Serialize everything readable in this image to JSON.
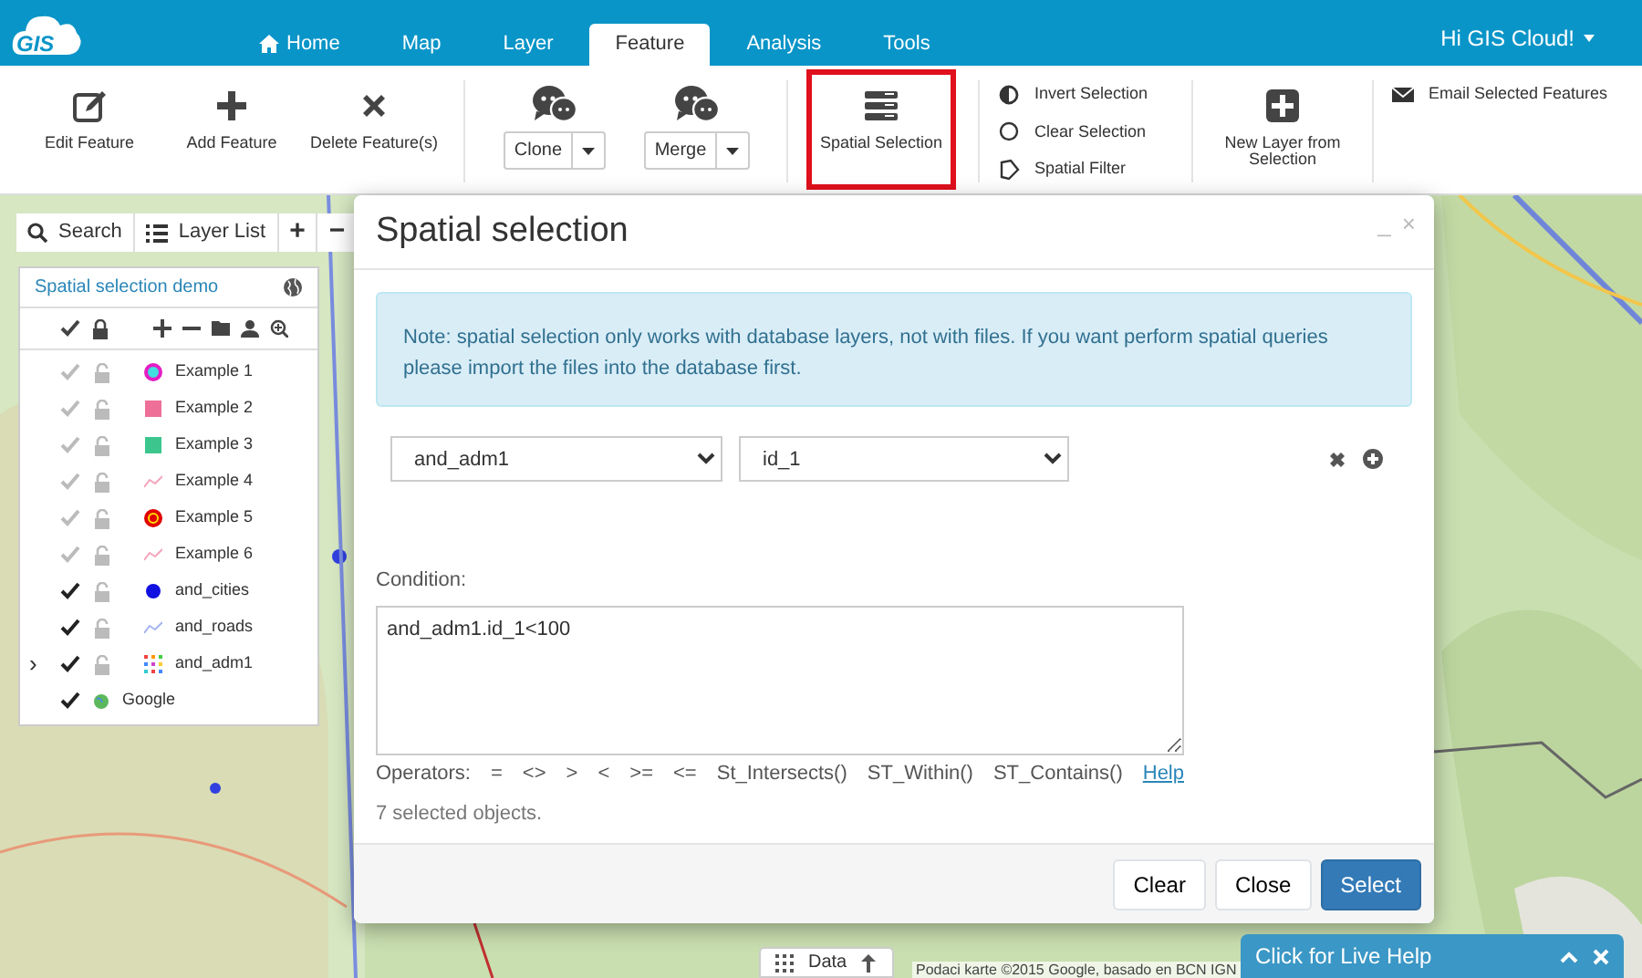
{
  "header": {
    "logo": "GIS",
    "tabs": [
      {
        "label": "Home",
        "selected": false
      },
      {
        "label": "Map",
        "selected": false
      },
      {
        "label": "Layer",
        "selected": false
      },
      {
        "label": "Feature",
        "selected": true
      },
      {
        "label": "Analysis",
        "selected": false
      },
      {
        "label": "Tools",
        "selected": false
      }
    ],
    "user": "Hi GIS Cloud!"
  },
  "toolbar": [
    {
      "kind": "big",
      "label": "Edit Feature"
    },
    {
      "kind": "big",
      "label": "Add Feature"
    },
    {
      "kind": "big",
      "label": "Delete Feature(s)"
    },
    {
      "kind": "divider"
    },
    {
      "kind": "split",
      "label": "Clone"
    },
    {
      "kind": "split",
      "label": "Merge"
    },
    {
      "kind": "divider"
    },
    {
      "kind": "big",
      "label": "Spatial Selection",
      "highlighted": true
    },
    {
      "kind": "divider"
    },
    {
      "kind": "list",
      "items": [
        "Invert Selection",
        "Clear Selection",
        "Spatial Filter"
      ]
    },
    {
      "kind": "divider"
    },
    {
      "kind": "big",
      "label": "New Layer from Selection"
    },
    {
      "kind": "divider"
    },
    {
      "kind": "list",
      "items": [
        "Email Selected Features"
      ]
    }
  ],
  "map_tools": {
    "search": "Search",
    "layer_list": "Layer List",
    "zoom_in": "+",
    "zoom_out": "−"
  },
  "layer_panel": {
    "title": "Spatial selection demo",
    "layers": [
      {
        "name": "Example 1",
        "visible": false,
        "locked": false,
        "kind": "point",
        "color": "#e41ec4"
      },
      {
        "name": "Example 2",
        "visible": false,
        "locked": false,
        "kind": "square",
        "color": "#ee6f98"
      },
      {
        "name": "Example 3",
        "visible": false,
        "locked": false,
        "kind": "square",
        "color": "#3cc68e"
      },
      {
        "name": "Example 4",
        "visible": false,
        "locked": false,
        "kind": "line",
        "color": "#f4a4bc"
      },
      {
        "name": "Example 5",
        "visible": false,
        "locked": false,
        "kind": "point",
        "color": "#e00000"
      },
      {
        "name": "Example 6",
        "visible": false,
        "locked": false,
        "kind": "line",
        "color": "#f4a4bc"
      },
      {
        "name": "and_cities",
        "visible": true,
        "locked": false,
        "kind": "point",
        "color": "#1010e0"
      },
      {
        "name": "and_roads",
        "visible": true,
        "locked": false,
        "kind": "line",
        "color": "#a4b4f0"
      },
      {
        "name": "and_adm1",
        "visible": true,
        "locked": false,
        "kind": "grid",
        "toggle": "›"
      },
      {
        "name": "Google",
        "visible": true,
        "kind": "globe"
      }
    ]
  },
  "dialog": {
    "title": "Spatial selection",
    "minimize": "_",
    "close": "×",
    "note": "Note: spatial selection only works with database layers, not with files. If you want perform spatial queries please import the files into the database first.",
    "selects": [
      "and_adm1",
      "id_1"
    ],
    "condition_label": "Condition:",
    "condition": "and_adm1.id_1<100",
    "operators_label": "Operators:",
    "operators": [
      "=",
      "<>",
      ">",
      "<",
      ">=",
      "<=",
      "St_Intersects()",
      "ST_Within()",
      "ST_Contains()"
    ],
    "help": "Help",
    "result": "7 selected objects.",
    "buttons": [
      {
        "label": "Clear",
        "primary": false
      },
      {
        "label": "Close",
        "primary": false
      },
      {
        "label": "Select",
        "primary": true
      }
    ]
  },
  "data_tab": "Data",
  "attribution": "Podaci karte ©2015 Google, basado en BCN IGN",
  "live_help": "Click for Live Help"
}
